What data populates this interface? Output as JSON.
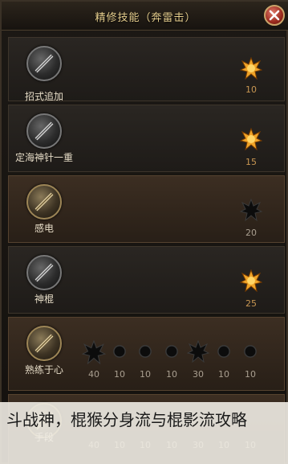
{
  "window": {
    "title": "精修技能（奔雷击）"
  },
  "skills": [
    {
      "name": "招式追加",
      "level": "10",
      "star": "gold",
      "icon": "staff-icon"
    },
    {
      "name": "定海神针一重",
      "level": "15",
      "star": "gold",
      "icon": "staff-icon"
    },
    {
      "name": "感电",
      "level": "20",
      "star": "dark",
      "icon": "staff-icon"
    },
    {
      "name": "神棍",
      "level": "25",
      "star": "gold",
      "icon": "staff-icon"
    },
    {
      "name": "熟练于心",
      "levels": [
        "40",
        "10",
        "10",
        "10",
        "30",
        "10",
        "10"
      ],
      "icon": "staff-icon"
    },
    {
      "name": "手段",
      "levels": [
        "40",
        "10",
        "10",
        "10",
        "30",
        "10",
        "10"
      ],
      "icon": "staff-icon"
    }
  ],
  "caption": {
    "text": "斗战神，棍猴分身流与棍影流攻略"
  },
  "colors": {
    "title": "#e7cf8e",
    "level_gold": "#c79652",
    "star_gold": "#f0a428",
    "star_dark": "#0c0c0c"
  }
}
